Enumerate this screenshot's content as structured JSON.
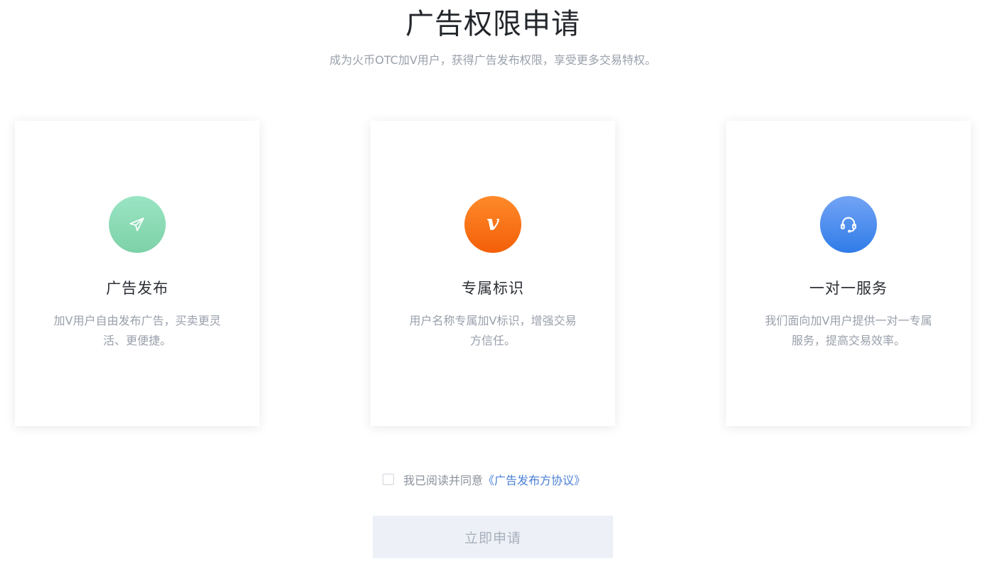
{
  "header": {
    "title": "广告权限申请",
    "subtitle": "成为火币OTC加V用户，获得广告发布权限，享受更多交易特权。"
  },
  "cards": [
    {
      "icon": "paper-plane-icon",
      "icon_color": "#86d8b0",
      "title": "广告发布",
      "desc": "加V用户自由发布广告，买卖更灵活、更便捷。"
    },
    {
      "icon": "v-badge-icon",
      "icon_glyph": "v",
      "icon_color": "#fb6f12",
      "title": "专属标识",
      "desc": "用户名称专属加V标识，增强交易方信任。"
    },
    {
      "icon": "headset-icon",
      "icon_color": "#3d86ec",
      "title": "一对一服务",
      "desc": "我们面向加V用户提供一对一专属服务，提高交易效率。"
    }
  ],
  "agreement": {
    "checked": false,
    "text": "我已阅读并同意",
    "link_text": "《广告发布方协议》"
  },
  "apply_button": {
    "label": "立即申请",
    "disabled": true
  },
  "colors": {
    "link": "#4a7fd6",
    "button_bg": "#edf1f7",
    "button_text": "#a8b0bd"
  }
}
